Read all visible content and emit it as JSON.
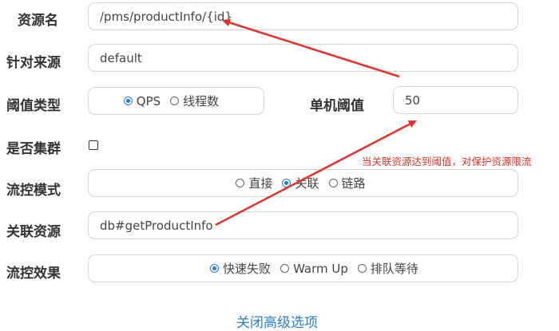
{
  "form": {
    "resource_name": {
      "label": "资源名",
      "value": "/pms/productInfo/{id}"
    },
    "limit_app": {
      "label": "针对来源",
      "value": "default"
    },
    "threshold_type": {
      "label": "阈值类型",
      "options": [
        {
          "label": "QPS",
          "checked": true
        },
        {
          "label": "线程数",
          "checked": false
        }
      ]
    },
    "single_threshold": {
      "label": "单机阈值",
      "value": "50"
    },
    "cluster": {
      "label": "是否集群",
      "checked": false
    },
    "control_mode": {
      "label": "流控模式",
      "options": [
        {
          "label": "直接",
          "checked": false
        },
        {
          "label": "关联",
          "checked": true
        },
        {
          "label": "链路",
          "checked": false
        }
      ]
    },
    "related_resource": {
      "label": "关联资源",
      "value": "db#getProductInfo"
    },
    "control_effect": {
      "label": "流控效果",
      "options": [
        {
          "label": "快速失败",
          "checked": true
        },
        {
          "label": "Warm Up",
          "checked": false
        },
        {
          "label": "排队等待",
          "checked": false
        }
      ]
    }
  },
  "annotation": {
    "text": "当关联资源达到阈值，对保护资源限流"
  },
  "advanced_link": {
    "label": "关闭高级选项"
  },
  "colors": {
    "accent": "#1e7be0",
    "annotation": "#e0332c",
    "link": "#2d7fc4",
    "border": "#cfd6df"
  }
}
